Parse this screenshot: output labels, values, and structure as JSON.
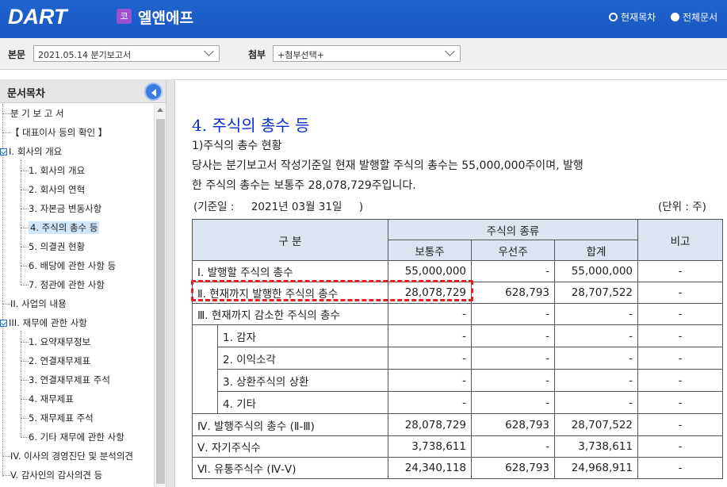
{
  "header": {
    "logo": "DART",
    "company_badge": "코",
    "company_name": "엘앤에프",
    "radio_current": "현재목차",
    "radio_all": "전체문서"
  },
  "toolbar": {
    "main_label": "본문",
    "main_value": "2021.05.14 분기보고서",
    "attach_label": "첨부",
    "attach_value": "+첨부선택+"
  },
  "sidebar": {
    "title": "문서목차",
    "items": [
      {
        "label": "분 기 보 고 서"
      },
      {
        "label": "【 대표이사 등의 확인 】"
      },
      {
        "label": "I. 회사의 개요"
      },
      {
        "label": "1. 회사의 개요"
      },
      {
        "label": "2. 회사의 연혁"
      },
      {
        "label": "3. 자본금 변동사항"
      },
      {
        "label": "4. 주식의 총수 등"
      },
      {
        "label": "5. 의결권 현황"
      },
      {
        "label": "6. 배당에 관한 사항 등"
      },
      {
        "label": "7. 정관에 관한 사항"
      },
      {
        "label": "II. 사업의 내용"
      },
      {
        "label": "III. 재무에 관한 사항"
      },
      {
        "label": "1. 요약재무정보"
      },
      {
        "label": "2. 연결재무제표"
      },
      {
        "label": "3. 연결재무제표 주석"
      },
      {
        "label": "4. 재무제표"
      },
      {
        "label": "5. 재무제표 주석"
      },
      {
        "label": "6. 기타 재무에 관한 사항"
      },
      {
        "label": "IV. 이사의 경영진단 및 분석의견"
      },
      {
        "label": "V. 감사인의 감사의견 등"
      }
    ]
  },
  "content": {
    "title": "4. 주식의 총수 등",
    "subtitle": "1)주식의 총수 현황",
    "para_line1": "당사는 분기보고서 작성기준일 현재 발행할 주식의 총수는 55,000,000주이며, 발행",
    "para_line2": "한 주식의 총수는 보통주 28,078,729주입니다.",
    "base_date": "(기준일 :     2021년 03월 31일     )",
    "unit": "(단위 : 주)",
    "table": {
      "h_category": "구  분",
      "h_kind": "주식의 종류",
      "h_remark": "비고",
      "h_common": "보통주",
      "h_preferred": "우선주",
      "h_total": "합계",
      "rows": [
        {
          "label": "Ⅰ. 발행할 주식의 총수",
          "common": "55,000,000",
          "preferred": "-",
          "total": "55,000,000",
          "remark": "-"
        },
        {
          "label": "Ⅱ. 현재까지 발행한 주식의 총수",
          "common": "28,078,729",
          "preferred": "628,793",
          "total": "28,707,522",
          "remark": "-"
        },
        {
          "label": "Ⅲ. 현재까지 감소한 주식의 총수",
          "common": "-",
          "preferred": "-",
          "total": "-",
          "remark": "-"
        },
        {
          "label": "1. 감자",
          "common": "-",
          "preferred": "-",
          "total": "-",
          "remark": "-"
        },
        {
          "label": "2. 이익소각",
          "common": "-",
          "preferred": "-",
          "total": "-",
          "remark": "-"
        },
        {
          "label": "3. 상환주식의 상환",
          "common": "-",
          "preferred": "-",
          "total": "-",
          "remark": "-"
        },
        {
          "label": "4. 기타",
          "common": "-",
          "preferred": "-",
          "total": "-",
          "remark": "-"
        },
        {
          "label": "Ⅳ. 발행주식의 총수 (Ⅱ-Ⅲ)",
          "common": "28,078,729",
          "preferred": "628,793",
          "total": "28,707,522",
          "remark": "-"
        },
        {
          "label": "Ⅴ. 자기주식수",
          "common": "3,738,611",
          "preferred": "-",
          "total": "3,738,611",
          "remark": "-"
        },
        {
          "label": "Ⅵ. 유통주식수 (Ⅳ-Ⅴ)",
          "common": "24,340,118",
          "preferred": "628,793",
          "total": "24,968,911",
          "remark": "-"
        }
      ]
    }
  }
}
